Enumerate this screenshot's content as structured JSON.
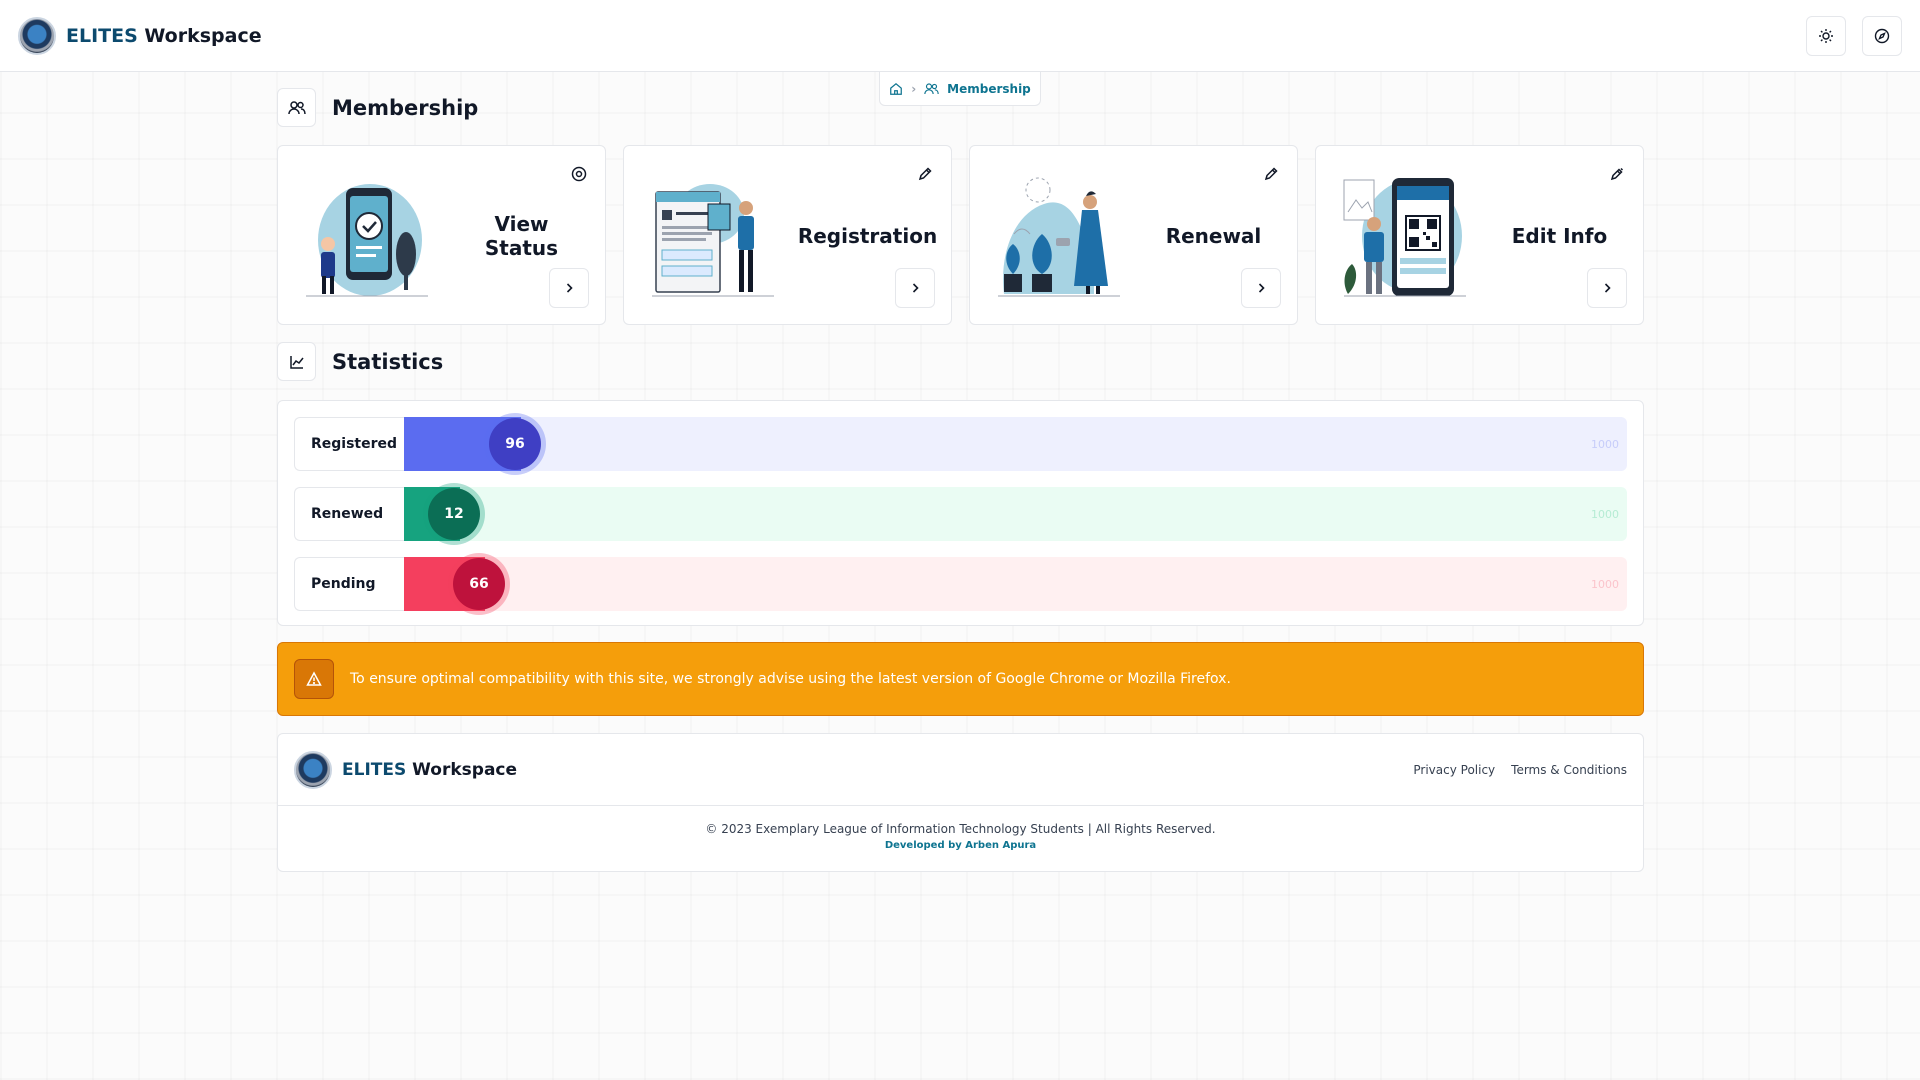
{
  "header": {
    "brand_primary": "ELITES",
    "brand_secondary": "Workspace",
    "actions": [
      {
        "icon": "sun-icon"
      },
      {
        "icon": "compass-icon"
      }
    ]
  },
  "breadcrumb": {
    "home_icon": "home-icon",
    "current": "Membership"
  },
  "membership": {
    "title": "Membership",
    "icon": "users-icon",
    "cards": [
      {
        "title": "View Status",
        "corner_icon": "target-icon",
        "illustration": "phone-check-illustration"
      },
      {
        "title": "Registration",
        "corner_icon": "pencil-icon",
        "illustration": "document-form-illustration"
      },
      {
        "title": "Renewal",
        "corner_icon": "pencil-icon",
        "illustration": "watering-plants-illustration"
      },
      {
        "title": "Edit Info",
        "corner_icon": "pen-icon",
        "illustration": "qr-phone-illustration"
      }
    ]
  },
  "statistics": {
    "title": "Statistics",
    "icon": "chart-icon",
    "max_label": "1000",
    "rows": [
      {
        "label": "Registered",
        "value": "96",
        "fill_fraction": 0.096,
        "fill_color": "#5b6cf0",
        "bubble_color": "#3f3fc4",
        "track_color": "#eef0fe",
        "max_color": "#c7cdfa"
      },
      {
        "label": "Renewed",
        "value": "12",
        "fill_fraction": 0.012,
        "fill_color": "#16a37f",
        "bubble_color": "#0b6e55",
        "track_color": "#eafcf3",
        "max_color": "#b6ecd4"
      },
      {
        "label": "Pending",
        "value": "66",
        "fill_fraction": 0.066,
        "fill_color": "#f43f5e",
        "bubble_color": "#be123c",
        "track_color": "#fff0f1",
        "max_color": "#fbc4cc"
      }
    ]
  },
  "alert": {
    "icon": "warning-icon",
    "text": "To ensure optimal compatibility with this site, we strongly advise using the latest version of Google Chrome or Mozilla Firefox."
  },
  "footer": {
    "brand_primary": "ELITES",
    "brand_secondary": "Workspace",
    "links": [
      "Privacy Policy",
      "Terms & Conditions"
    ],
    "copyright": "© 2023 Exemplary League of Information Technology Students | All Rights Reserved.",
    "developer": "Developed by Arben Apura"
  }
}
